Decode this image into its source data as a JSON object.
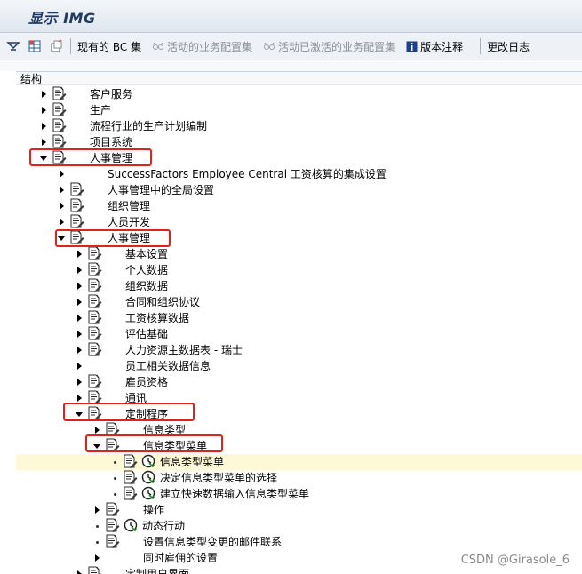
{
  "window": {
    "title": "显示 IMG"
  },
  "toolbar": {
    "buttons": [
      {
        "label": "现有的 BC 集",
        "enabled": true
      },
      {
        "label": "活动的业务配置集",
        "enabled": false
      },
      {
        "label": "活动已激活的业务配置集",
        "enabled": false
      },
      {
        "label": "版本注释",
        "enabled": true
      },
      {
        "label": "更改日志",
        "enabled": true
      }
    ]
  },
  "structure": {
    "header": "结构",
    "rows": [
      {
        "label": "客户服务",
        "level": 0,
        "expander": "collapsed",
        "doc": true,
        "clock": false
      },
      {
        "label": "生产",
        "level": 0,
        "expander": "collapsed",
        "doc": true,
        "clock": false
      },
      {
        "label": "流程行业的生产计划编制",
        "level": 0,
        "expander": "collapsed",
        "doc": true,
        "clock": false
      },
      {
        "label": "项目系统",
        "level": 0,
        "expander": "collapsed",
        "doc": true,
        "clock": false
      },
      {
        "label": "人事管理",
        "level": 0,
        "expander": "expanded",
        "doc": true,
        "clock": false,
        "boxed": true
      },
      {
        "label": "SuccessFactors Employee Central 工资核算的集成设置",
        "level": 1,
        "expander": "collapsed",
        "doc": false,
        "clock": false
      },
      {
        "label": "人事管理中的全局设置",
        "level": 1,
        "expander": "collapsed",
        "doc": true,
        "clock": false
      },
      {
        "label": "组织管理",
        "level": 1,
        "expander": "collapsed",
        "doc": true,
        "clock": false
      },
      {
        "label": "人员开发",
        "level": 1,
        "expander": "collapsed",
        "doc": true,
        "clock": false
      },
      {
        "label": "人事管理",
        "level": 1,
        "expander": "expanded",
        "doc": true,
        "clock": false,
        "boxed": true
      },
      {
        "label": "基本设置",
        "level": 2,
        "expander": "collapsed",
        "doc": true,
        "clock": false
      },
      {
        "label": "个人数据",
        "level": 2,
        "expander": "collapsed",
        "doc": true,
        "clock": false
      },
      {
        "label": "组织数据",
        "level": 2,
        "expander": "collapsed",
        "doc": true,
        "clock": false
      },
      {
        "label": "合同和组织协议",
        "level": 2,
        "expander": "collapsed",
        "doc": true,
        "clock": false
      },
      {
        "label": "工资核算数据",
        "level": 2,
        "expander": "collapsed",
        "doc": true,
        "clock": false
      },
      {
        "label": "评估基础",
        "level": 2,
        "expander": "collapsed",
        "doc": true,
        "clock": false
      },
      {
        "label": "人力资源主数据表 - 瑞士",
        "level": 2,
        "expander": "collapsed",
        "doc": true,
        "clock": false
      },
      {
        "label": "员工相关数据信息",
        "level": 2,
        "expander": "collapsed",
        "doc": false,
        "clock": false
      },
      {
        "label": "雇员资格",
        "level": 2,
        "expander": "collapsed",
        "doc": true,
        "clock": false
      },
      {
        "label": "通讯",
        "level": 2,
        "expander": "collapsed",
        "doc": true,
        "clock": false
      },
      {
        "label": "定制程序",
        "level": 2,
        "expander": "expanded",
        "doc": true,
        "clock": false,
        "boxed": true
      },
      {
        "label": "信息类型",
        "level": 3,
        "expander": "collapsed",
        "doc": true,
        "clock": false
      },
      {
        "label": "信息类型菜单",
        "level": 3,
        "expander": "expanded",
        "doc": true,
        "clock": false,
        "boxed": true
      },
      {
        "label": "信息类型菜单",
        "level": 4,
        "expander": "leaf",
        "doc": true,
        "clock": true,
        "highlight": true
      },
      {
        "label": "决定信息类型菜单的选择",
        "level": 4,
        "expander": "leaf",
        "doc": true,
        "clock": true
      },
      {
        "label": "建立快速数据输入信息类型菜单",
        "level": 4,
        "expander": "leaf",
        "doc": true,
        "clock": true
      },
      {
        "label": "操作",
        "level": 3,
        "expander": "collapsed",
        "doc": true,
        "clock": false
      },
      {
        "label": "动态行动",
        "level": 3,
        "expander": "leaf",
        "doc": true,
        "clock": true
      },
      {
        "label": "设置信息类型变更的邮件联系",
        "level": 3,
        "expander": "leaf",
        "doc": true,
        "clock": false
      },
      {
        "label": "同时雇佣的设置",
        "level": 3,
        "expander": "collapsed",
        "doc": false,
        "clock": false
      },
      {
        "label": "定制用户界面",
        "level": 2,
        "expander": "collapsed",
        "doc": true,
        "clock": false
      }
    ]
  },
  "watermark": "CSDN @Girasole_6",
  "colors": {
    "highlight_box": "#e4201b",
    "row_highlight": "#fdf8d5",
    "title": "#1f3a64"
  }
}
